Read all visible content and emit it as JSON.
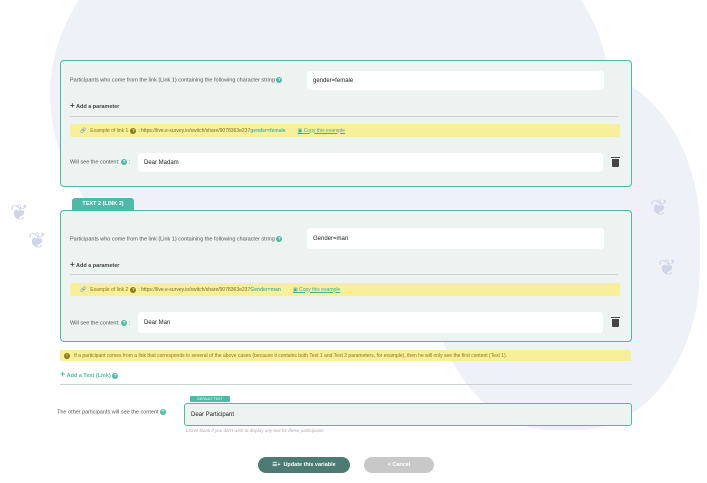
{
  "text1": {
    "participants_label": "Participants who come from the link (Link 1) containing the following character string",
    "param_value": "gender=female",
    "add_parameter": "Add a parameter",
    "example_prefix": "Example of link 1",
    "example_url": ": https://live.e-survey.io/switch/share/9078363e237",
    "example_highlight": "gender=female",
    "copy_label": "Copy this example",
    "content_label": "Will see the content:",
    "content_value": "Dear Madam"
  },
  "text2": {
    "tab_label": "TEXT 2 (LINK 2)",
    "participants_label": "Participants who come from the link (Link 1) containing the following character string",
    "param_value": "Gender=man",
    "add_parameter": "Add a parameter",
    "example_prefix": "Example of link 2",
    "example_url": ": https://live.e-survey.io/switch/share/9078363e237",
    "example_highlight": "Gender=man",
    "copy_label": "Copy this example",
    "content_label": "Will see the content:",
    "content_value": "Dear Man"
  },
  "warning_text": "If a participant comes from a link that corresponds to several of the above cases (because it contains both Text 1 and Text 2 parameters, for example), then he will only see the first content (Text 1).",
  "add_text_link": "Add a Text (Link)",
  "default": {
    "badge": "DEFAULT TEXT",
    "label": "The other participants will see the content",
    "value": "Dear Participant",
    "hint": "Leave blank if you don't wish to display any text for these participants"
  },
  "buttons": {
    "update": "Update this variable",
    "cancel": "< Cancel"
  },
  "colors": {
    "accent": "#4fb8a6",
    "dark_button": "#4d7a72",
    "cancel_button": "#c8c8c8",
    "warning_bg": "#f7ef9a"
  }
}
